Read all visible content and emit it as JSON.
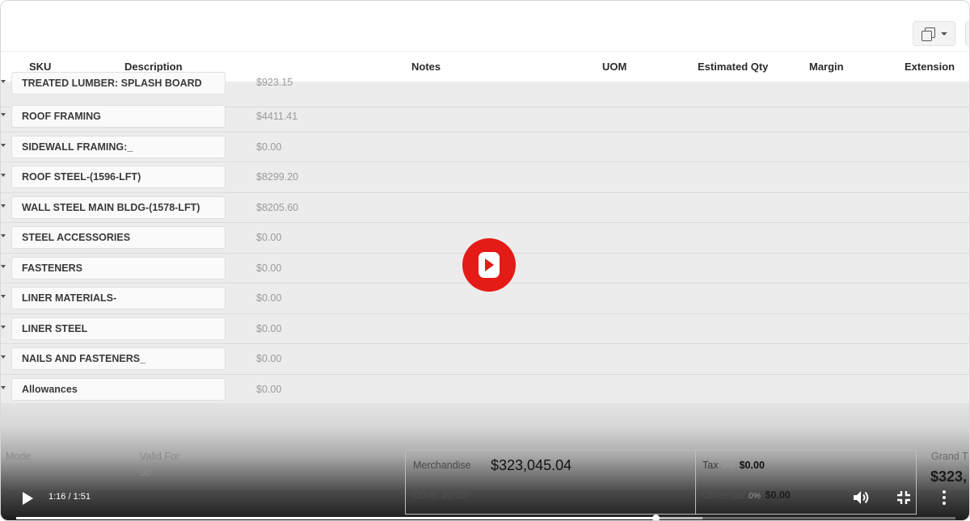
{
  "table": {
    "columns": {
      "sku": "SKU",
      "description": "Description",
      "notes": "Notes",
      "uom": "UOM",
      "estimated_qty": "Estimated Qty",
      "margin": "Margin",
      "extension": "Extension"
    },
    "rows": [
      {
        "label": "TREATED LUMBER: SPLASH BOARD",
        "amount": "$923.15"
      },
      {
        "label": "ROOF FRAMING",
        "amount": "$4411.41"
      },
      {
        "label": "SIDEWALL FRAMING:_",
        "amount": "$0.00"
      },
      {
        "label": "ROOF STEEL-(1596-LFT)",
        "amount": "$8299.20"
      },
      {
        "label": "WALL STEEL MAIN BLDG-(1578-LFT)",
        "amount": "$8205.60"
      },
      {
        "label": "STEEL ACCESSORIES",
        "amount": "$0.00"
      },
      {
        "label": "FASTENERS",
        "amount": "$0.00"
      },
      {
        "label": "LINER MATERIALS-",
        "amount": "$0.00"
      },
      {
        "label": "LINER STEEL",
        "amount": "$0.00"
      },
      {
        "label": "NAILS AND FASTENERS_",
        "amount": "$0.00"
      },
      {
        "label": "Allowances",
        "amount": "$0.00"
      }
    ]
  },
  "footer": {
    "mode_label": "Mode",
    "valid_for_label": "Valid For",
    "valid_for_value": "30",
    "merchandise_label": "Merchandise",
    "merchandise_value": "$323,045.04",
    "other_label": "Other",
    "other_value": "$0.00",
    "tax_label": "Tax",
    "tax_pct": "0%",
    "tax_value": "$0.00",
    "other_tax_label": "Other tax",
    "other_tax_pct": "0%",
    "other_tax_value": "$0.00",
    "grand_total_label": "Grand T",
    "grand_total_value": "$323,"
  },
  "player": {
    "time": "1:16 / 1:51",
    "progress": 0.681,
    "buffered": 0.731,
    "accent_color": "#e41b17"
  },
  "icons": {
    "view_toggle": "copy-icon",
    "center_play": "play-icon",
    "play": "play-icon",
    "volume": "volume-icon",
    "exit_fullscreen": "exit-fullscreen-icon",
    "more": "more-vertical-icon"
  }
}
